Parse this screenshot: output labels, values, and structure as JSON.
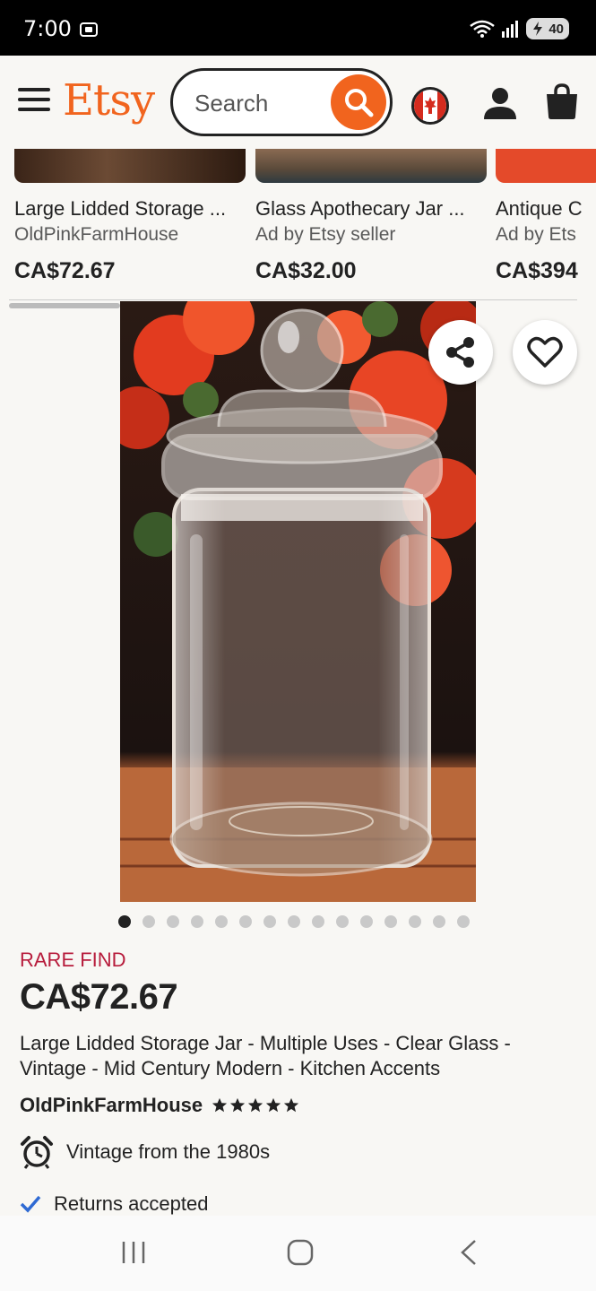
{
  "status_bar": {
    "time": "7:00",
    "battery": "40"
  },
  "header": {
    "logo": "Etsy",
    "search_placeholder": "Search"
  },
  "listings": [
    {
      "title": "Large Lidded Storage ...",
      "seller": "OldPinkFarmHouse",
      "price": "CA$72.67"
    },
    {
      "title": "Glass Apothecary Jar ...",
      "seller": "Ad by Etsy seller",
      "price": "CA$32.00"
    },
    {
      "title": "Antique C",
      "seller": "Ad by Ets",
      "price": "CA$394"
    }
  ],
  "product": {
    "badge": "RARE FIND",
    "price": "CA$72.67",
    "title": "Large Lidded Storage Jar - Multiple Uses - Clear Glass - Vintage - Mid Century Modern - Kitchen Accents",
    "shop": "OldPinkFarmHouse",
    "rating_stars": 5,
    "image_count": 15,
    "current_image": 1,
    "features": [
      {
        "icon": "alarm-clock-icon",
        "text": "Vintage from the 1980s"
      },
      {
        "icon": "checkmark-icon",
        "text": "Returns accepted"
      }
    ]
  },
  "colors": {
    "brand": "#f1641e",
    "rare": "#b71c3c"
  }
}
